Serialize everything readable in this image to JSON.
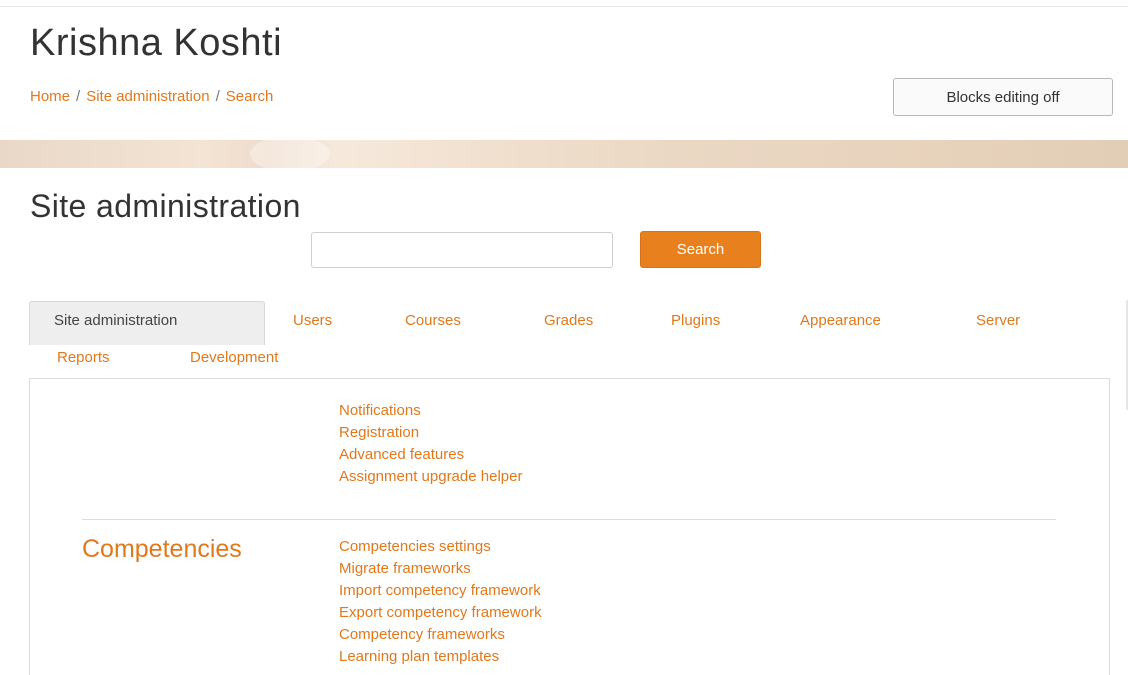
{
  "site": {
    "title": "Krishna Koshti"
  },
  "breadcrumb": {
    "items": [
      "Home",
      "Site administration",
      "Search"
    ],
    "separator": "/"
  },
  "header": {
    "blocks_editing_label": "Blocks editing off"
  },
  "page": {
    "heading": "Site administration"
  },
  "search": {
    "value": "",
    "placeholder": "",
    "button_label": "Search"
  },
  "tabs": [
    {
      "label": "Site administration",
      "active": true
    },
    {
      "label": "Users"
    },
    {
      "label": "Courses"
    },
    {
      "label": "Grades"
    },
    {
      "label": "Plugins"
    },
    {
      "label": "Appearance"
    },
    {
      "label": "Server"
    },
    {
      "label": "Reports"
    },
    {
      "label": "Development"
    }
  ],
  "sections": [
    {
      "heading": "",
      "links": [
        "Notifications",
        "Registration",
        "Advanced features",
        "Assignment upgrade helper"
      ]
    },
    {
      "heading": "Competencies",
      "links": [
        "Competencies settings",
        "Migrate frameworks",
        "Import competency framework",
        "Export competency framework",
        "Competency frameworks",
        "Learning plan templates"
      ]
    }
  ],
  "colors": {
    "accent": "#e8801e",
    "link": "#e0781c",
    "text": "#333333"
  }
}
